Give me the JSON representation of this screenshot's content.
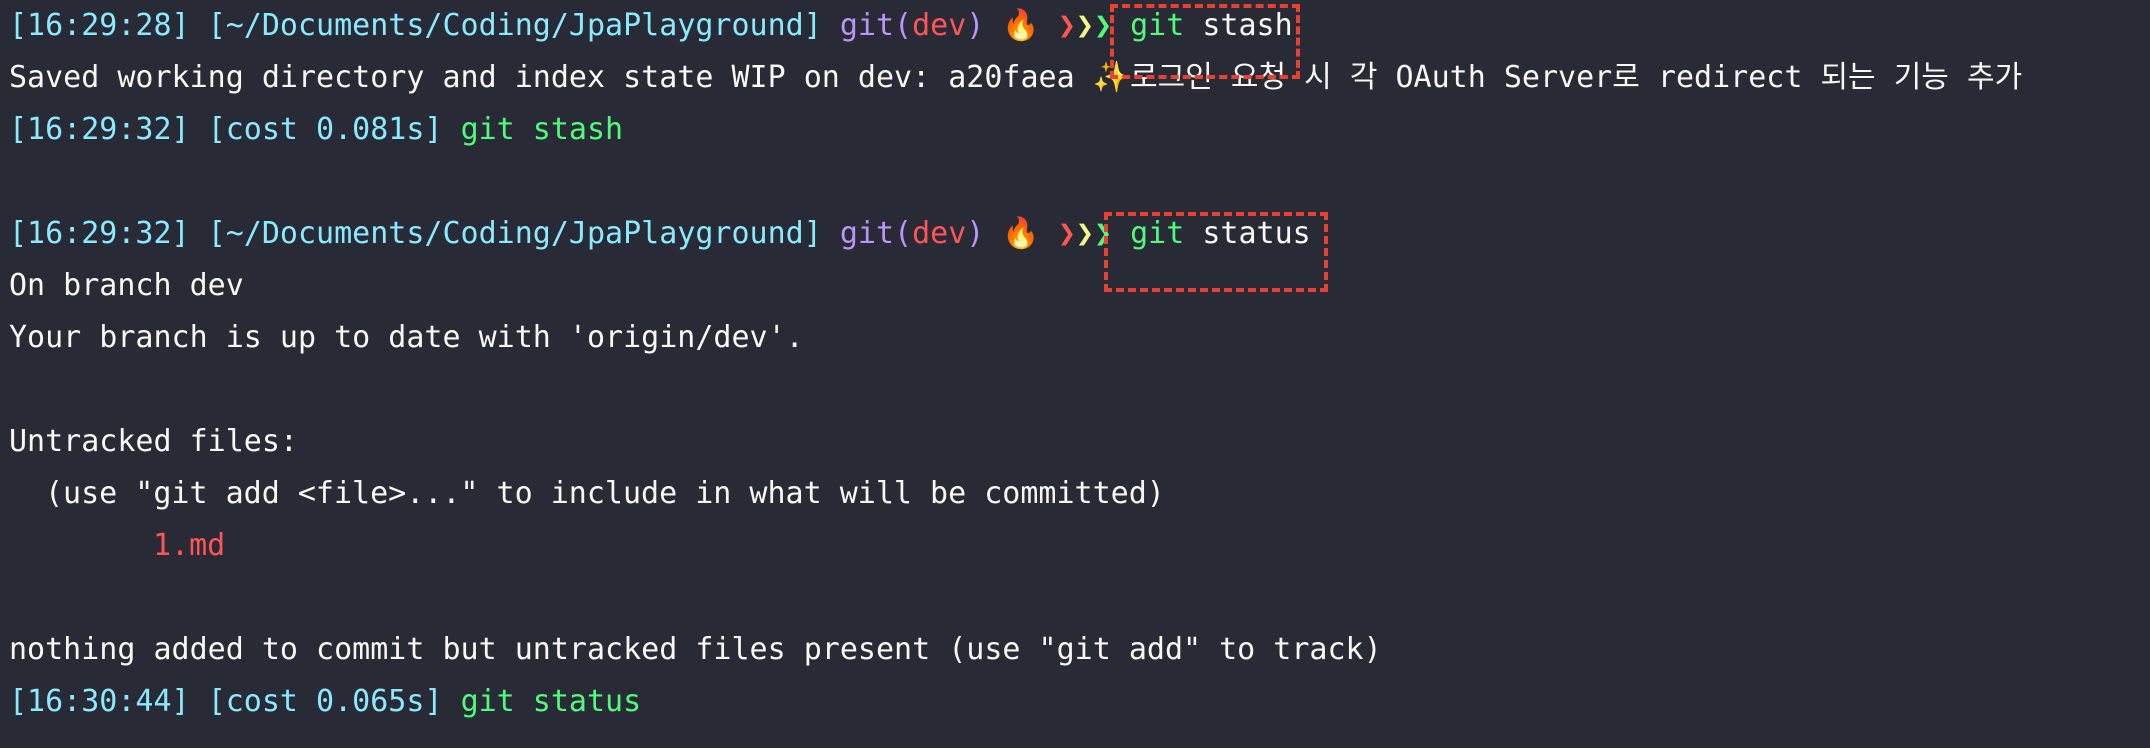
{
  "terminal": {
    "block1": {
      "prompt": {
        "time": "[16:29:28]",
        "path": "[~/Documents/Coding/JpaPlayground]",
        "git_label": "git(",
        "branch": "dev",
        "git_close": ")",
        "fire_icon": "🔥",
        "chevrons": [
          "❯",
          "❯",
          "❯"
        ],
        "command_git": "git",
        "command_arg": "stash"
      },
      "output": [
        "Saved working directory and index state WIP on dev: a20faea ✨로그인 요청 시 각 OAuth Server로 redirect 되는 기능 추가"
      ],
      "footer": {
        "time": "[16:29:32]",
        "cost": "[cost 0.081s]",
        "command": "git stash"
      }
    },
    "block2": {
      "prompt": {
        "time": "[16:29:32]",
        "path": "[~/Documents/Coding/JpaPlayground]",
        "git_label": "git(",
        "branch": "dev",
        "git_close": ")",
        "fire_icon": "🔥",
        "chevrons": [
          "❯",
          "❯",
          "❯"
        ],
        "command_git": "git",
        "command_arg": "status"
      },
      "output": {
        "on_branch": "On branch dev",
        "up_to_date": "Your branch is up to date with 'origin/dev'.",
        "untracked_header": "Untracked files:",
        "hint": "(use \"git add <file>...\" to include in what will be committed)",
        "untracked_file": "1.md",
        "summary": "nothing added to commit but untracked files present (use \"git add\" to track)"
      },
      "footer": {
        "time": "[16:30:44]",
        "cost": "[cost 0.065s]",
        "command": "git status"
      }
    },
    "colors": {
      "background": "#282a36",
      "time_and_path": "#8be9fd",
      "git_label": "#bd93f9",
      "branch": "#ff5555",
      "command": "#50fa7b",
      "untracked_file": "#ff5555",
      "highlight_box": "#e8412f"
    }
  }
}
